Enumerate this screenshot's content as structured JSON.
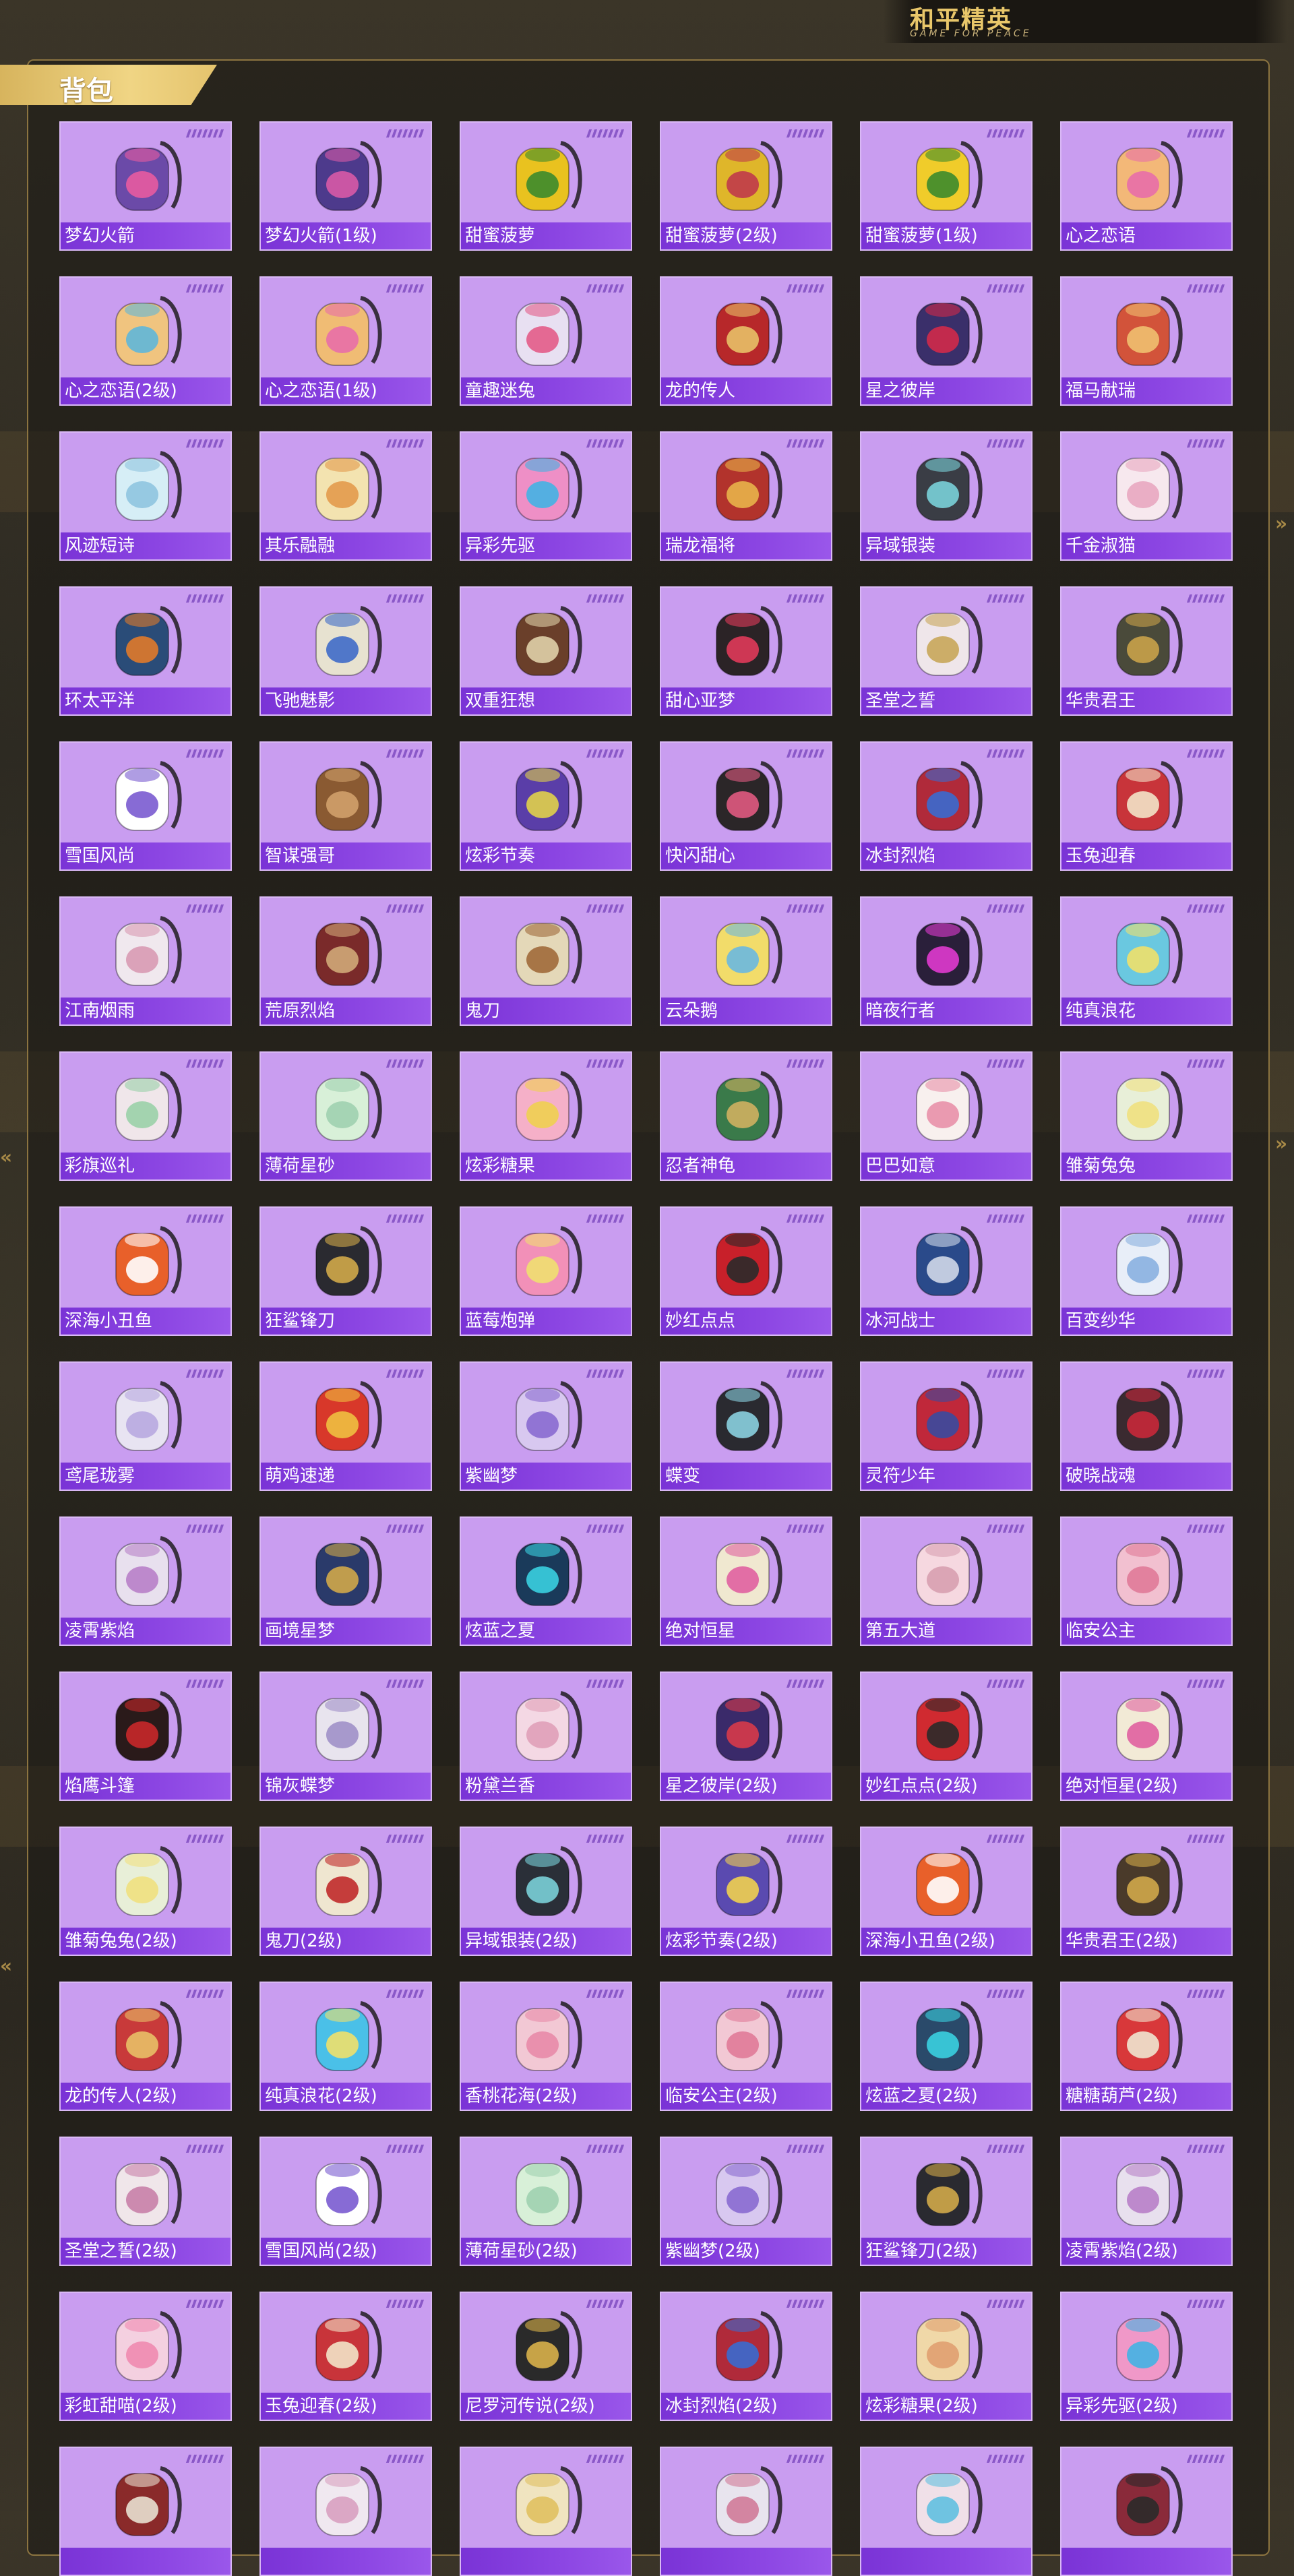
{
  "logo": {
    "title": "和平精英",
    "subtitle": "GAME FOR PEACE"
  },
  "section": {
    "title": "背包"
  },
  "items": [
    {
      "name": "梦幻火箭",
      "color": "#6b4aa8",
      "accent": "#e85ba0"
    },
    {
      "name": "梦幻火箭(1级)",
      "color": "#4d3a8c",
      "accent": "#d85aa6"
    },
    {
      "name": "甜蜜菠萝",
      "color": "#e9c21f",
      "accent": "#3c8b2c"
    },
    {
      "name": "甜蜜菠萝(2级)",
      "color": "#dfb62a",
      "accent": "#c03a4a"
    },
    {
      "name": "甜蜜菠萝(1级)",
      "color": "#f0cc2a",
      "accent": "#3c8b2c"
    },
    {
      "name": "心之恋语",
      "color": "#f3b878",
      "accent": "#e86ea8"
    },
    {
      "name": "心之恋语(2级)",
      "color": "#f0c47f",
      "accent": "#5fb7d9"
    },
    {
      "name": "心之恋语(1级)",
      "color": "#f0bc74",
      "accent": "#e86ea8"
    },
    {
      "name": "童趣迷兔",
      "color": "#e8e0f2",
      "accent": "#e35c88"
    },
    {
      "name": "龙的传人",
      "color": "#b7282a",
      "accent": "#e8c067"
    },
    {
      "name": "星之彼岸",
      "color": "#3a2f6a",
      "accent": "#d12a4a"
    },
    {
      "name": "福马献瑞",
      "color": "#d2533a",
      "accent": "#f0c070"
    },
    {
      "name": "风迹短诗",
      "color": "#d6eef6",
      "accent": "#8fc4e0"
    },
    {
      "name": "其乐融融",
      "color": "#f3e3b0",
      "accent": "#e39a4c"
    },
    {
      "name": "异彩先驱",
      "color": "#ee8fc6",
      "accent": "#43b3e3"
    },
    {
      "name": "瑞龙福将",
      "color": "#b2332c",
      "accent": "#e8b24a"
    },
    {
      "name": "异域银装",
      "color": "#3a3d45",
      "accent": "#7ad0d8"
    },
    {
      "name": "千金淑猫",
      "color": "#f7e8ee",
      "accent": "#e8a7c0"
    },
    {
      "name": "环太平洋",
      "color": "#2a4c78",
      "accent": "#e07a2a"
    },
    {
      "name": "飞驰魅影",
      "color": "#e7e2d0",
      "accent": "#3f6cc8"
    },
    {
      "name": "双重狂想",
      "color": "#6a3f2a",
      "accent": "#e0d0a8"
    },
    {
      "name": "甜心亚梦",
      "color": "#2b2326",
      "accent": "#e03a5a"
    },
    {
      "name": "圣堂之誓",
      "color": "#efe6ea",
      "accent": "#c8a65a"
    },
    {
      "name": "华贵君王",
      "color": "#4a4a3a",
      "accent": "#c9a24a"
    },
    {
      "name": "雪国风尚",
      "color": "#ffffff",
      "accent": "#7a5bd0"
    },
    {
      "name": "智谋强哥",
      "color": "#8a5a32",
      "accent": "#d0a06a"
    },
    {
      "name": "炫彩节奏",
      "color": "#5a3ea8",
      "accent": "#e0d04a"
    },
    {
      "name": "快闪甜心",
      "color": "#2b2628",
      "accent": "#e05a80"
    },
    {
      "name": "冰封烈焰",
      "color": "#b02a3a",
      "accent": "#3a6ad0"
    },
    {
      "name": "玉兔迎春",
      "color": "#c8343a",
      "accent": "#f2e3c8"
    },
    {
      "name": "江南烟雨",
      "color": "#f0e8ee",
      "accent": "#d89ab2"
    },
    {
      "name": "荒原烈焰",
      "color": "#7a2a2a",
      "accent": "#d0a878"
    },
    {
      "name": "鬼刀",
      "color": "#e4d8b8",
      "accent": "#a06a3a"
    },
    {
      "name": "云朵鹅",
      "color": "#f2dc6a",
      "accent": "#6ab8e0"
    },
    {
      "name": "暗夜行者",
      "color": "#2a1f3a",
      "accent": "#e03ad0"
    },
    {
      "name": "纯真浪花",
      "color": "#6ac8e0",
      "accent": "#f0e06a"
    },
    {
      "name": "彩旗巡礼",
      "color": "#f0e6ea",
      "accent": "#9ad0a8"
    },
    {
      "name": "薄荷星砂",
      "color": "#d8f0d8",
      "accent": "#a0d0b0"
    },
    {
      "name": "炫彩糖果",
      "color": "#f5b0c8",
      "accent": "#f0d050"
    },
    {
      "name": "忍者神龟",
      "color": "#3a7a4a",
      "accent": "#d0b060"
    },
    {
      "name": "巴巴如意",
      "color": "#f8f0ee",
      "accent": "#e890a8"
    },
    {
      "name": "雏菊兔兔",
      "color": "#e8efd8",
      "accent": "#f0e080"
    },
    {
      "name": "深海小丑鱼",
      "color": "#e8602a",
      "accent": "#ffffff"
    },
    {
      "name": "狂鲨锋刀",
      "color": "#2a2a30",
      "accent": "#d0a84a"
    },
    {
      "name": "蓝莓炮弹",
      "color": "#f290b8",
      "accent": "#f0e070"
    },
    {
      "name": "妙红点点",
      "color": "#c8202a",
      "accent": "#2a2a2a"
    },
    {
      "name": "冰河战士",
      "color": "#2a4a8a",
      "accent": "#d0d8e8"
    },
    {
      "name": "百变纱华",
      "color": "#e8eef8",
      "accent": "#8ab0e0"
    },
    {
      "name": "鸢尾珑雾",
      "color": "#e8e4f2",
      "accent": "#b8a8e0"
    },
    {
      "name": "萌鸡速递",
      "color": "#d8382a",
      "accent": "#f0c040"
    },
    {
      "name": "紫幽梦",
      "color": "#d8c8f0",
      "accent": "#8a6ad0"
    },
    {
      "name": "蝶变",
      "color": "#2a2a30",
      "accent": "#8ad0e0"
    },
    {
      "name": "灵符少年",
      "color": "#c0283a",
      "accent": "#3a4aa0"
    },
    {
      "name": "破晓战魂",
      "color": "#3a2a30",
      "accent": "#c8283a"
    },
    {
      "name": "凌霄紫焰",
      "color": "#e8e0ee",
      "accent": "#b880c8"
    },
    {
      "name": "画境星梦",
      "color": "#2a3a6a",
      "accent": "#d0a84a"
    },
    {
      "name": "炫蓝之夏",
      "color": "#1a3a5a",
      "accent": "#3ad0e0"
    },
    {
      "name": "绝对恒星",
      "color": "#f0e8d0",
      "accent": "#e060a0"
    },
    {
      "name": "第五大道",
      "color": "#f6d8e0",
      "accent": "#d8a0b0"
    },
    {
      "name": "临安公主",
      "color": "#f2c0d0",
      "accent": "#e07a98"
    },
    {
      "name": "焰鹰斗篷",
      "color": "#2a1a1a",
      "accent": "#c8282a"
    },
    {
      "name": "锦灰蝶梦",
      "color": "#e8e4ee",
      "accent": "#a090c8"
    },
    {
      "name": "粉黛兰香",
      "color": "#f4d8e4",
      "accent": "#e0a0b8"
    },
    {
      "name": "星之彼岸(2级)",
      "color": "#3a2a6a",
      "accent": "#d83a4a"
    },
    {
      "name": "妙红点点(2级)",
      "color": "#d02a30",
      "accent": "#2a2a2a"
    },
    {
      "name": "绝对恒星(2级)",
      "color": "#f2ead6",
      "accent": "#e060a0"
    },
    {
      "name": "雏菊兔兔(2级)",
      "color": "#e8efd8",
      "accent": "#f0e080"
    },
    {
      "name": "鬼刀(2级)",
      "color": "#efe6d0",
      "accent": "#c02a2a"
    },
    {
      "name": "异域银装(2级)",
      "color": "#2a2f38",
      "accent": "#7ad0d8"
    },
    {
      "name": "炫彩节奏(2级)",
      "color": "#5a4ab0",
      "accent": "#f0d050"
    },
    {
      "name": "深海小丑鱼(2级)",
      "color": "#e8602a",
      "accent": "#ffffff"
    },
    {
      "name": "华贵君王(2级)",
      "color": "#4a3a2a",
      "accent": "#d0a84a"
    },
    {
      "name": "龙的传人(2级)",
      "color": "#c83a3a",
      "accent": "#e8c067"
    },
    {
      "name": "纯真浪花(2级)",
      "color": "#4ac0e8",
      "accent": "#f0e06a"
    },
    {
      "name": "香桃花海(2级)",
      "color": "#f2c8d4",
      "accent": "#e88aa8"
    },
    {
      "name": "临安公主(2级)",
      "color": "#f2c8d4",
      "accent": "#e07a98"
    },
    {
      "name": "炫蓝之夏(2级)",
      "color": "#2a4a6a",
      "accent": "#3ad0e0"
    },
    {
      "name": "糖糖葫芦(2级)",
      "color": "#d8383a",
      "accent": "#f0e6d0"
    },
    {
      "name": "圣堂之誓(2级)",
      "color": "#f0e6ea",
      "accent": "#c880a8"
    },
    {
      "name": "雪国风尚(2级)",
      "color": "#ffffff",
      "accent": "#7a5bd0"
    },
    {
      "name": "薄荷星砂(2级)",
      "color": "#d8f0d8",
      "accent": "#a0d0b0"
    },
    {
      "name": "紫幽梦(2级)",
      "color": "#d8c8f0",
      "accent": "#8a6ad0"
    },
    {
      "name": "狂鲨锋刀(2级)",
      "color": "#2a2a30",
      "accent": "#d0a84a"
    },
    {
      "name": "凌霄紫焰(2级)",
      "color": "#e8e0ee",
      "accent": "#b880c8"
    },
    {
      "name": "彩虹甜喵(2级)",
      "color": "#f4d0e0",
      "accent": "#f08ab0"
    },
    {
      "name": "玉兔迎春(2级)",
      "color": "#c8343a",
      "accent": "#f2e3c8"
    },
    {
      "name": "尼罗河传说(2级)",
      "color": "#2a2a2a",
      "accent": "#d8b04a"
    },
    {
      "name": "冰封烈焰(2级)",
      "color": "#b02a3a",
      "accent": "#3a6ad0"
    },
    {
      "name": "炫彩糖果(2级)",
      "color": "#f0d8a8",
      "accent": "#e0a070"
    },
    {
      "name": "异彩先驱(2级)",
      "color": "#f098c8",
      "accent": "#43b3e3"
    },
    {
      "name": "",
      "color": "#8a2a2a",
      "accent": "#e8e0d0"
    },
    {
      "name": "",
      "color": "#f0e8f0",
      "accent": "#d8a0c0"
    },
    {
      "name": "",
      "color": "#f0e4c0",
      "accent": "#e0c060"
    },
    {
      "name": "",
      "color": "#e8e4ee",
      "accent": "#d07a98"
    },
    {
      "name": "",
      "color": "#f0e0e8",
      "accent": "#60c0e0"
    },
    {
      "name": "",
      "color": "#8a2a3a",
      "accent": "#2a2a2a"
    }
  ]
}
